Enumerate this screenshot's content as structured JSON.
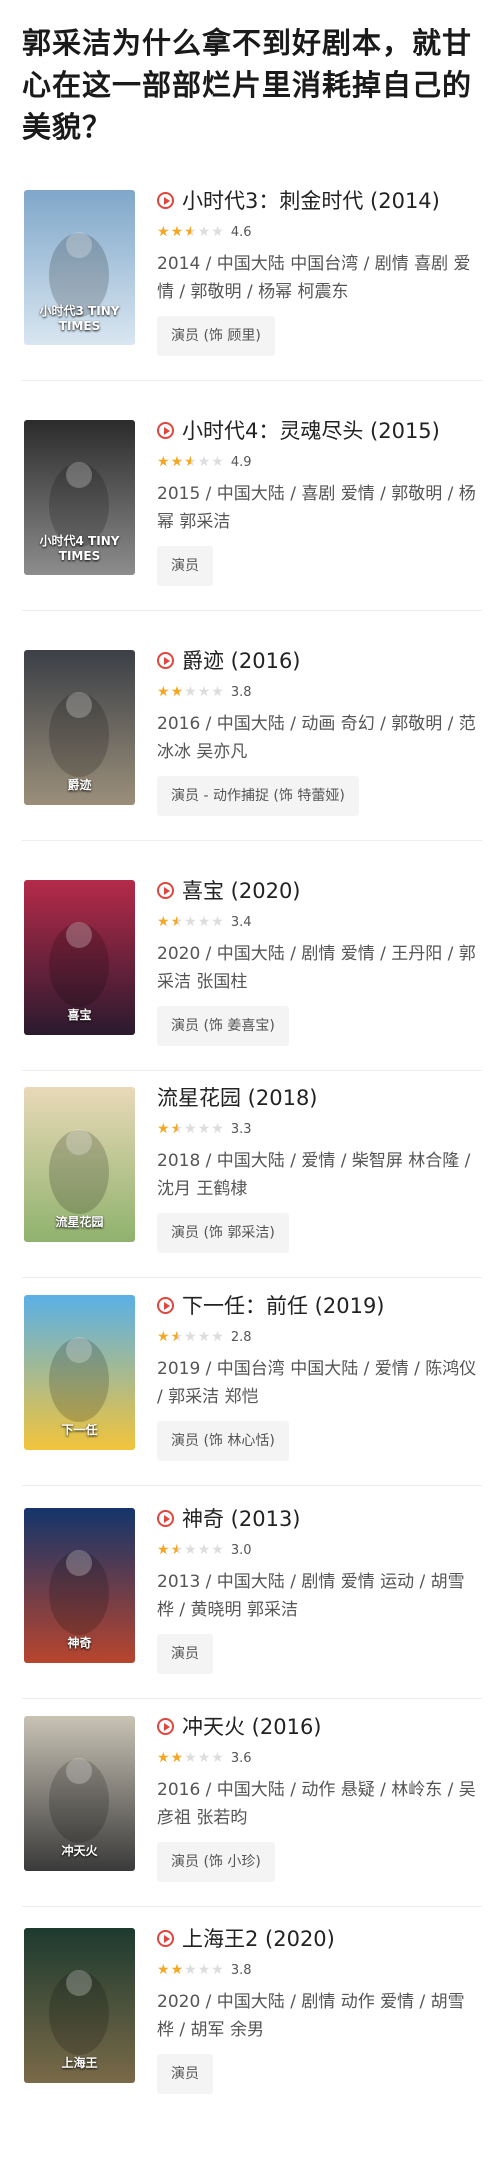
{
  "headline": "郭采洁为什么拿不到好剧本，就甘心在这一部部烂片里消耗掉自己的美貌？",
  "colors": {
    "accent": "#e0453f",
    "star": "#f5a623"
  },
  "movies": [
    {
      "title": "小时代3：刺金时代 (2014)",
      "play": true,
      "rating": "4.6",
      "stars": 2.5,
      "meta": "2014 / 中国大陆 中国台湾 / 剧情 喜剧 爱情 / 郭敬明 / 杨幂 柯震东",
      "role": "演员 (饰 顾里)",
      "poster_text": "小时代3 TINY TIMES"
    },
    {
      "title": "小时代4：灵魂尽头 (2015)",
      "play": true,
      "rating": "4.9",
      "stars": 2.5,
      "meta": "2015 / 中国大陆 / 喜剧 爱情 / 郭敬明 / 杨幂 郭采洁",
      "role": "演员",
      "poster_text": "小时代4 TINY TIMES"
    },
    {
      "title": "爵迹 (2016)",
      "play": true,
      "rating": "3.8",
      "stars": 2,
      "meta": "2016 / 中国大陆 / 动画 奇幻 / 郭敬明 / 范冰冰 吴亦凡",
      "role": "演员 - 动作捕捉 (饰 特蕾娅)",
      "poster_text": "爵迹"
    },
    {
      "title": "喜宝 (2020)",
      "play": true,
      "rating": "3.4",
      "stars": 1.5,
      "meta": "2020 / 中国大陆 / 剧情 爱情 / 王丹阳 / 郭采洁 张国柱",
      "role": "演员 (饰 姜喜宝)",
      "poster_text": "喜宝"
    },
    {
      "title": "流星花园 (2018)",
      "play": false,
      "rating": "3.3",
      "stars": 1.5,
      "meta": "2018 / 中国大陆 / 爱情 / 柴智屏 林合隆 / 沈月 王鹤棣",
      "role": "演员 (饰 郭采洁)",
      "poster_text": "流星花园"
    },
    {
      "title": "下一任：前任 (2019)",
      "play": true,
      "rating": "2.8",
      "stars": 1.5,
      "meta": "2019 / 中国台湾 中国大陆 / 爱情 / 陈鸿仪 / 郭采洁 郑恺",
      "role": "演员 (饰 林心恬)",
      "poster_text": "下一任"
    },
    {
      "title": "神奇 (2013)",
      "play": true,
      "rating": "3.0",
      "stars": 1.5,
      "meta": "2013 / 中国大陆 / 剧情 爱情 运动 / 胡雪桦 / 黄晓明 郭采洁",
      "role": "演员",
      "poster_text": "神奇"
    },
    {
      "title": "冲天火 (2016)",
      "play": true,
      "rating": "3.6",
      "stars": 2,
      "meta": "2016 / 中国大陆 / 动作 悬疑 / 林岭东 / 吴彦祖 张若昀",
      "role": "演员 (饰 小珍)",
      "poster_text": "冲天火"
    },
    {
      "title": "上海王2 (2020)",
      "play": true,
      "rating": "3.8",
      "stars": 2,
      "meta": "2020 / 中国大陆 / 剧情 动作 爱情 / 胡雪桦 / 胡军 余男",
      "role": "演员",
      "poster_text": "上海王"
    }
  ]
}
